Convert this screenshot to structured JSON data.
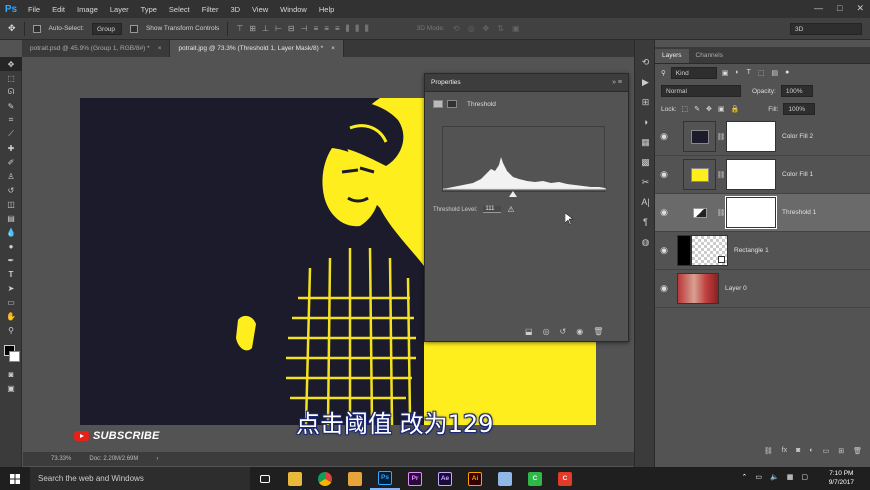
{
  "app": {
    "logo": "Ps",
    "menu": [
      "File",
      "Edit",
      "Image",
      "Layer",
      "Type",
      "Select",
      "Filter",
      "3D",
      "View",
      "Window",
      "Help"
    ],
    "window_controls": [
      "—",
      "□",
      "✕"
    ]
  },
  "options_bar": {
    "auto_select_label": "Auto-Select:",
    "auto_select_value": "Group",
    "transform_controls_label": "Show Transform Controls",
    "mode_3d_label": "3D Mode:",
    "workspace": "3D"
  },
  "tabs": [
    {
      "label": "potrait.psd @ 45.9% (Group 1, RGB/8#) *",
      "close": "×"
    },
    {
      "label": "potrait.jpg @ 73.3% (Threshold 1, Layer Mask/8) *",
      "close": "×"
    }
  ],
  "status_bar": {
    "zoom": "73.33%",
    "doc_size": "Doc: 2.20M/2.69M",
    "arrow": "›"
  },
  "overlay": {
    "subscribe": "SUBSCRIBE",
    "caption": "点击阈值 改为129"
  },
  "properties": {
    "title": "Properties",
    "adjustment": "Threshold",
    "threshold_label": "Threshold Level:",
    "threshold_value": "111"
  },
  "layers_panel": {
    "tabs": [
      "Layers",
      "Channels"
    ],
    "filter": "Kind",
    "blend_mode": "Normal",
    "opacity_label": "Opacity:",
    "opacity": "100%",
    "lock_label": "Lock:",
    "fill_label": "Fill:",
    "fill": "100%",
    "layers": [
      {
        "name": "Color Fill 2",
        "thumb_color": "#1c1b2b",
        "has_mask": true,
        "selected": false
      },
      {
        "name": "Color Fill 1",
        "thumb_color": "#ffee1e",
        "has_mask": true,
        "selected": false
      },
      {
        "name": "Threshold 1",
        "thumb_color": "adjustment",
        "has_mask": true,
        "selected": true
      },
      {
        "name": "Rectangle 1",
        "thumb_color": "#000000",
        "has_mask": false,
        "selected": false
      },
      {
        "name": "Layer 0",
        "thumb_color": "photo",
        "has_mask": false,
        "selected": false
      }
    ]
  },
  "taskbar": {
    "search_placeholder": "Search the web and Windows",
    "apps": [
      {
        "icon": "task-view",
        "label": "",
        "bg": "transparent",
        "fg": "#fff"
      },
      {
        "icon": "file-explorer",
        "label": "",
        "bg": "#e8b93a",
        "fg": "#000"
      },
      {
        "icon": "chrome",
        "label": "",
        "bg": "#db4437",
        "fg": "#fff"
      },
      {
        "icon": "folder",
        "label": "",
        "bg": "#e8a33a",
        "fg": "#000"
      },
      {
        "icon": "photoshop",
        "label": "Ps",
        "bg": "#001e36",
        "fg": "#31a8ff"
      },
      {
        "icon": "premiere",
        "label": "Pr",
        "bg": "#2a0a3a",
        "fg": "#e58bff"
      },
      {
        "icon": "after-effects",
        "label": "Ae",
        "bg": "#1a0a3a",
        "fg": "#c6a8ff"
      },
      {
        "icon": "illustrator",
        "label": "Ai",
        "bg": "#330000",
        "fg": "#ff9a00"
      },
      {
        "icon": "notepad",
        "label": "",
        "bg": "#8fb8e8",
        "fg": "#000"
      },
      {
        "icon": "camtasia-green",
        "label": "C",
        "bg": "#2eb84a",
        "fg": "#fff"
      },
      {
        "icon": "camtasia-red",
        "label": "C",
        "bg": "#e23b2a",
        "fg": "#fff"
      }
    ],
    "time": "7:10 PM",
    "date": "9/7/2017"
  },
  "colors": {
    "canvas_yellow": "#ffee1e",
    "canvas_dark": "#1c1b2b",
    "selection": "#6a6a6a"
  }
}
